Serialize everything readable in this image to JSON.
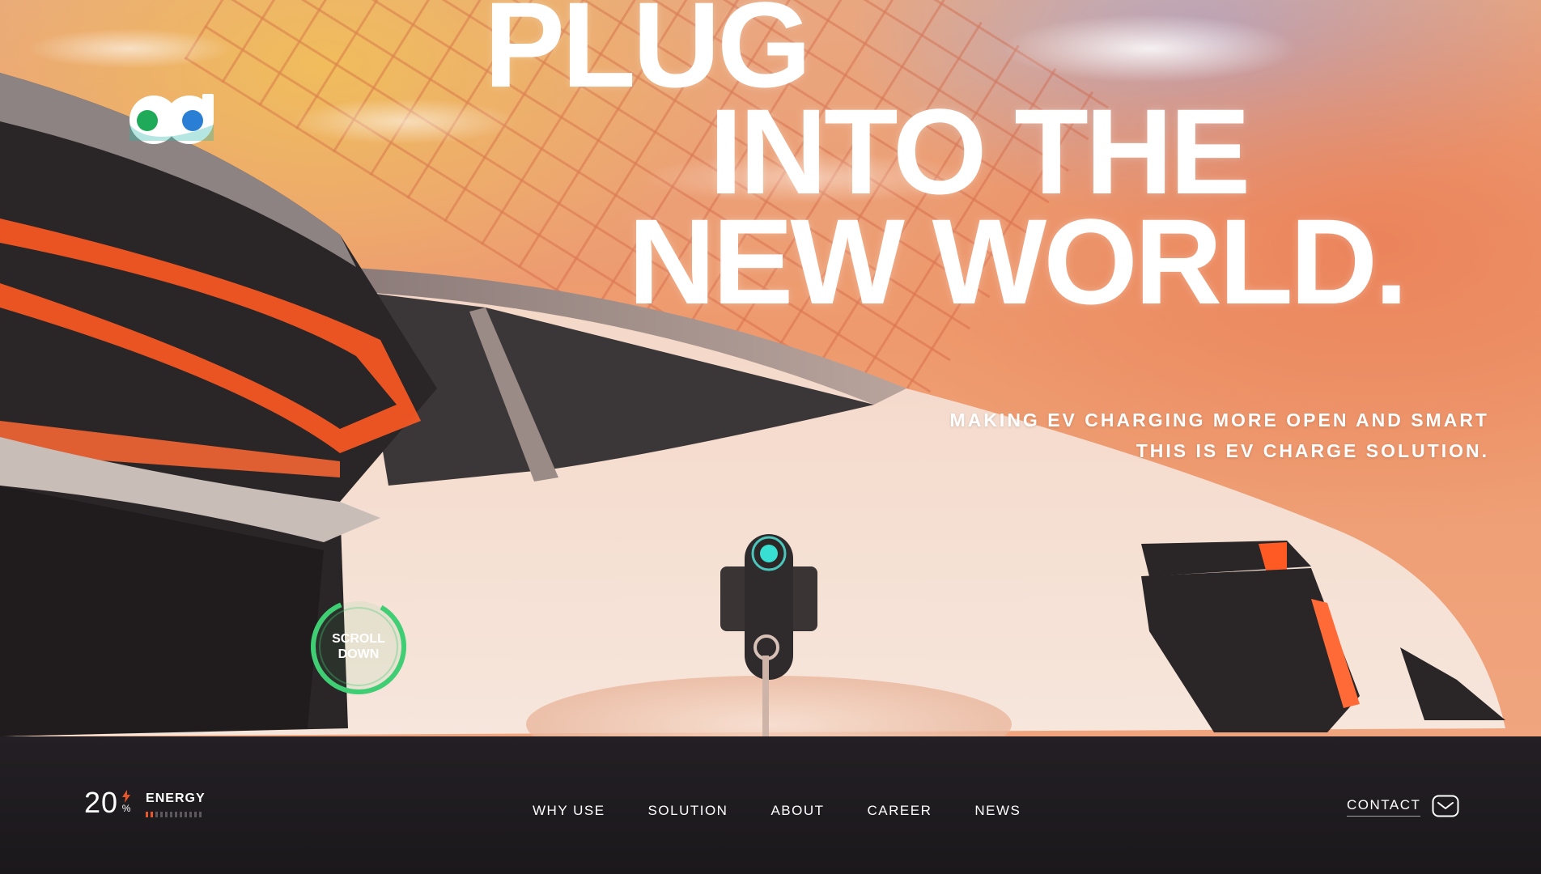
{
  "brand": {
    "logo_name": "od-logo",
    "colors": {
      "green": "#1faa59",
      "blue": "#2a7fd4",
      "teal": "#2bb6a8"
    }
  },
  "hero": {
    "headline": [
      "PLUG",
      "INTO THE",
      "NEW WORLD."
    ],
    "tagline": [
      "MAKING EV CHARGING MORE OPEN AND SMART",
      "THIS IS EV CHARGE SOLUTION."
    ],
    "scroll_button": "SCROLL\nDOWN",
    "colors": {
      "scroll_ring": "#3fce74",
      "charger_light": "#37e0d2",
      "tail_light": "#ff5a24"
    }
  },
  "status": {
    "energy_value": "20",
    "energy_unit": "%",
    "energy_label": "ENERGY",
    "energy_level": 0.2,
    "icon": "bolt-icon",
    "colors": {
      "bar_active": "#e8572b",
      "bar_inactive": "#5b575c"
    }
  },
  "nav": {
    "items": [
      {
        "label": "WHY USE"
      },
      {
        "label": "SOLUTION"
      },
      {
        "label": "ABOUT"
      },
      {
        "label": "CAREER"
      },
      {
        "label": "NEWS"
      }
    ]
  },
  "contact": {
    "label": "CONTACT",
    "icon": "mail-icon"
  }
}
